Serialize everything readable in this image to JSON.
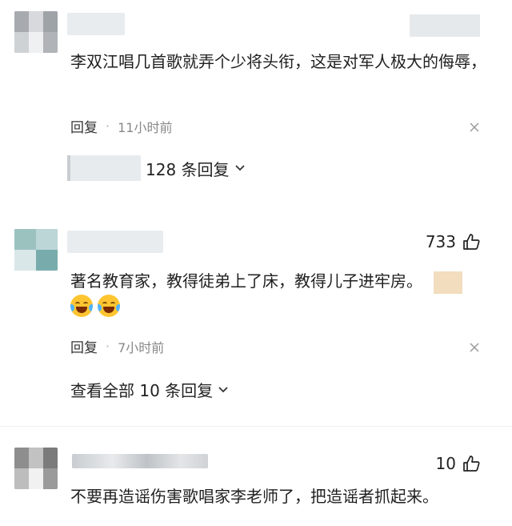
{
  "comments": [
    {
      "text": "李双江唱几首歌就弄个少将头衔，这是对军人极大的侮辱，",
      "reply_label": "回复",
      "time": "11小时前",
      "sub_replies": "128 条回复"
    },
    {
      "likes": "733",
      "text": "著名教育家，教得徒弟上了床，教得儿子进牢房。",
      "emojis": [
        "laugh-cry-emoji",
        "laugh-cry-emoji"
      ],
      "reply_label": "回复",
      "time": "7小时前",
      "sub_replies": "查看全部 10 条回复"
    },
    {
      "likes": "10",
      "text": "不要再造谣伤害歌唱家李老师了，把造谣者抓起来。"
    }
  ],
  "separator": "·",
  "colors": {
    "emoji": "#ffc531",
    "sticker": "#f3ddbf"
  }
}
